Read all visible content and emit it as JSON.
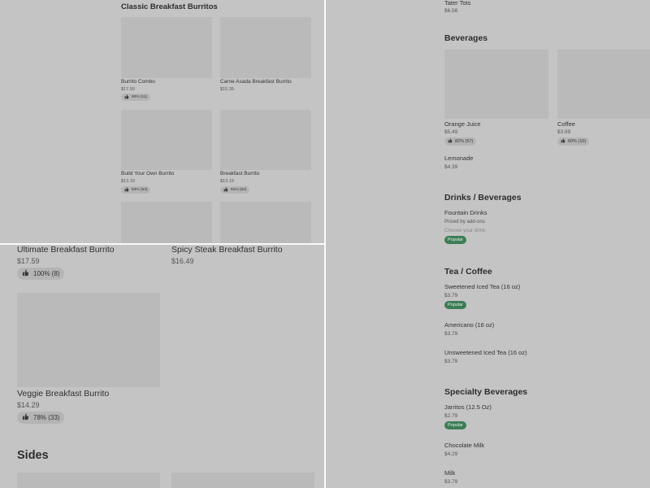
{
  "top_left": {
    "section_title": "Classic Breakfast Burritos",
    "items": [
      {
        "name": "Burrito Combo",
        "price": "$17.59",
        "rating": "90% (11)"
      },
      {
        "name": "Carne Asada Breakfast Burrito",
        "price": "$15.39",
        "rating": ""
      },
      {
        "name": "Build Your Own Burrito",
        "price": "$13.19",
        "rating": "83% (54)"
      },
      {
        "name": "Breakfast Burrito",
        "price": "$13.19",
        "rating": "81% (82)"
      }
    ]
  },
  "bottom_left": {
    "items": [
      {
        "name": "Ultimate Breakfast Burrito",
        "price": "$17.59",
        "rating": "100% (8)"
      },
      {
        "name": "Spicy Steak Breakfast Burrito",
        "price": "$16.49",
        "rating": ""
      },
      {
        "name": "Veggie Breakfast Burrito",
        "price": "$14.29",
        "rating": "78% (33)"
      }
    ],
    "sides_title": "Sides"
  },
  "right": {
    "tater_tots": {
      "name": "Tater Tots",
      "price": "$6.56"
    },
    "beverages": {
      "title": "Beverages",
      "items": [
        {
          "name": "Orange Juice",
          "price": "$5.49",
          "rating": "82% (57)"
        },
        {
          "name": "Coffee",
          "price": "$3.89",
          "rating": "60% (10)"
        },
        {
          "name": "Lemonade",
          "price": "$4.39"
        }
      ]
    },
    "drinks": {
      "title": "Drinks / Beverages",
      "item": {
        "name": "Fountain Drinks",
        "subtitle": "Priced by add-ons",
        "note": "Choose your drink.",
        "badge": "Popular"
      }
    },
    "tea": {
      "title": "Tea / Coffee",
      "items": [
        {
          "name": "Sweetened Iced Tea (16 oz)",
          "price": "$3.79",
          "badge": "Popular"
        },
        {
          "name": "Americano (16 oz)",
          "price": "$3.79"
        },
        {
          "name": "Unsweetened Iced Tea (16 oz)",
          "price": "$3.79"
        }
      ]
    },
    "specialty": {
      "title": "Specialty Beverages",
      "items": [
        {
          "name": "Jarritos (12.5 Oz)",
          "price": "$2.79",
          "badge": "Popular"
        },
        {
          "name": "Chocolate Milk",
          "price": "$4.29"
        },
        {
          "name": "Milk",
          "price": "$3.79"
        }
      ]
    }
  },
  "colors": {
    "popular_badge": "#3b7d55",
    "background": "#c4c4c4",
    "divider": "#fafafa"
  }
}
